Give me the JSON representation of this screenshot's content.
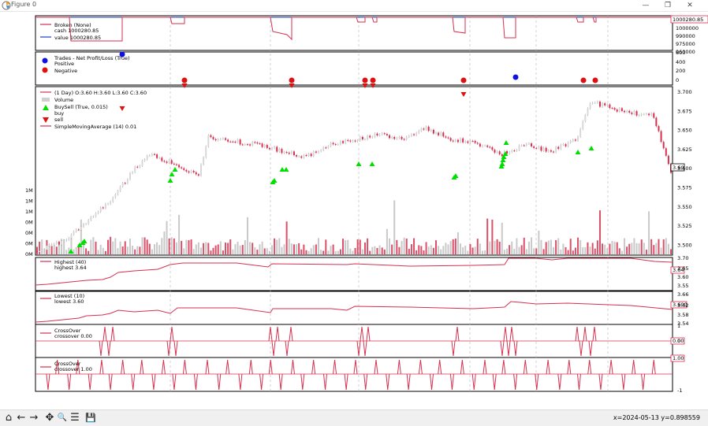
{
  "window": {
    "title": "Figure 0",
    "minimize": "—",
    "restore": "❐",
    "close": "✕"
  },
  "status": {
    "coords": "x=2024-05-13 y=0.898559"
  },
  "toolbar": {
    "home": "⌂",
    "back": "←",
    "forward": "→",
    "pan": "✥",
    "zoom": "🔍",
    "config": "☰",
    "save": "💾"
  },
  "broker_panel": {
    "legend_title": "Broken (None)",
    "cash_label": "cash 1000280.85",
    "value_label": "value 1000280.85",
    "last_value_tag": "1000280.85",
    "yticks": [
      "1000000",
      "990000",
      "975000",
      "960000"
    ],
    "colors": {
      "cash": "#d6304f",
      "value": "#1f3fbf"
    }
  },
  "trades_panel": {
    "legend_title": "Trades - Net Profit/Loss (True)",
    "positive_label": "Positive",
    "negative_label": "Negative",
    "yticks": [
      "600",
      "400",
      "200",
      "0"
    ],
    "colors": {
      "positive": "#1010e0",
      "negative": "#e01010"
    }
  },
  "price_panel": {
    "ohlc_label": "(1 Day) O:3.60 H:3.60 L:3.60 C:3.60",
    "volume_label": "Volume",
    "buysell_label": "BuySell (True, 0.015)",
    "buy_label": "buy",
    "sell_label": "sell",
    "sma_label": "SimpleMovingAverage (14) 0.01",
    "last_price_tag": "3.60",
    "yticks": [
      "3.700",
      "3.675",
      "3.650",
      "3.625",
      "3.600",
      "3.575",
      "3.550",
      "3.525",
      "3.500"
    ],
    "volume_ticks": [
      "1M",
      "1M",
      "1M",
      "0M",
      "0M",
      "0M",
      "0M"
    ],
    "colors": {
      "up": "#cfcfcf",
      "down": "#d6304f",
      "buy": "#00e000",
      "sell": "#e01010"
    }
  },
  "highest_panel": {
    "legend_title": "Highest (40)",
    "value_label": "highest 3.64",
    "tag": "3.64",
    "yticks": [
      "3.70",
      "3.65",
      "3.60",
      "3.55"
    ]
  },
  "lowest_panel": {
    "legend_title": "Lowest (10)",
    "value_label": "lowest 3.60",
    "tag": "3.600",
    "yticks": [
      "3.66",
      "3.62",
      "3.58",
      "3.54"
    ]
  },
  "crossover1_panel": {
    "legend_title": "CrossOver",
    "value_label": "crossover 0.00",
    "tag": "0.00",
    "yticks": [
      "1",
      "0",
      "-1"
    ]
  },
  "crossover2_panel": {
    "legend_title": "CrossOver",
    "value_label": "crossover 1.00",
    "tag": "1.00",
    "yticks": [
      "1",
      "-1"
    ]
  }
}
